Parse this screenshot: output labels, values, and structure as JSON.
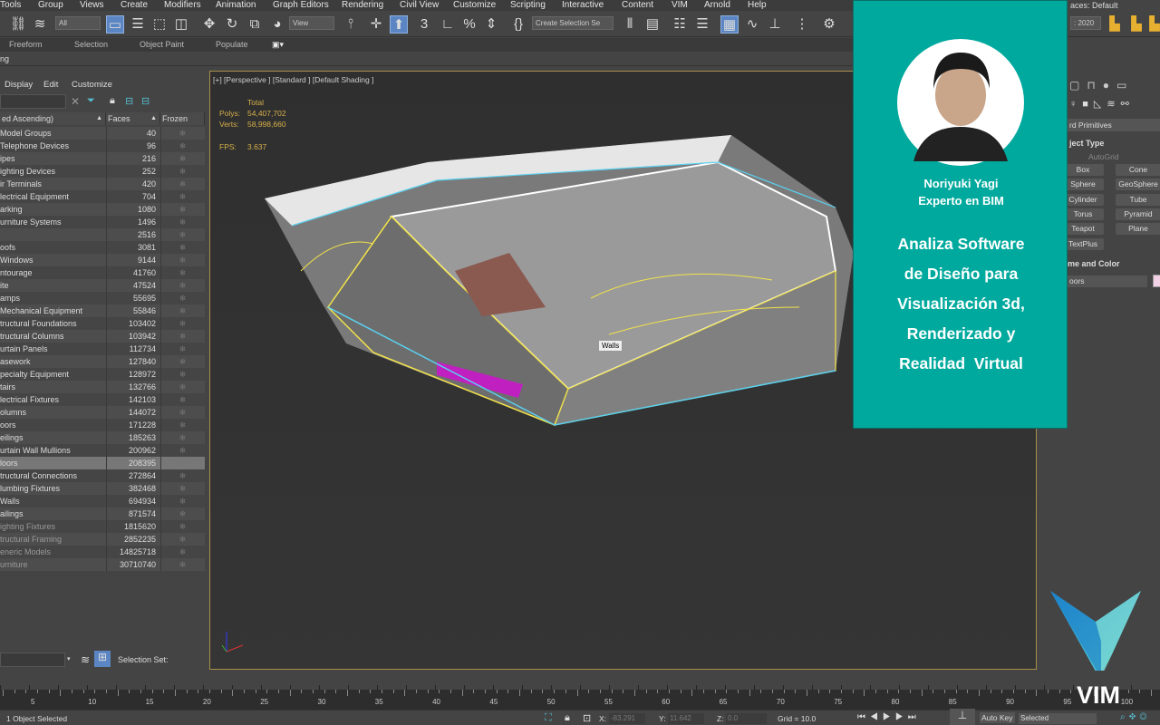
{
  "menu": [
    "Tools",
    "Group",
    "Views",
    "Create",
    "Modifiers",
    "Animation",
    "Graph Editors",
    "Rendering",
    "Civil View",
    "Customize",
    "Scripting",
    "Interactive",
    "Content",
    "VIM",
    "Arnold",
    "Help"
  ],
  "toolbar": {
    "filter": "All",
    "ref_coord": "View",
    "selection_set": "Create Selection Se",
    "workspace_label": "aces:",
    "workspace": "Default",
    "project": ": 2020"
  },
  "ribbon": [
    "Freeform",
    "Selection",
    "Object Paint",
    "Populate"
  ],
  "row2_text": "ng",
  "explorer": {
    "menu": [
      "Display",
      "Edit",
      "Customize"
    ],
    "columns": [
      "ed Ascending)",
      "Faces",
      "Frozen"
    ],
    "rows": [
      [
        "Model Groups",
        "40"
      ],
      [
        "Telephone Devices",
        "96"
      ],
      [
        "ipes",
        "216"
      ],
      [
        "ighting Devices",
        "252"
      ],
      [
        "ir Terminals",
        "420"
      ],
      [
        "lectrical Equipment",
        "704"
      ],
      [
        "arking",
        "1080"
      ],
      [
        "urniture Systems",
        "1496"
      ],
      [
        "",
        "2516"
      ],
      [
        "oofs",
        "3081"
      ],
      [
        "Windows",
        "9144"
      ],
      [
        "ntourage",
        "41760"
      ],
      [
        "ite",
        "47524"
      ],
      [
        "amps",
        "55695"
      ],
      [
        "Mechanical Equipment",
        "55846"
      ],
      [
        "tructural Foundations",
        "103402"
      ],
      [
        "tructural Columns",
        "103942"
      ],
      [
        "urtain Panels",
        "112734"
      ],
      [
        "asework",
        "127840"
      ],
      [
        "pecialty Equipment",
        "128972"
      ],
      [
        "tairs",
        "132766"
      ],
      [
        "lectrical Fixtures",
        "142103"
      ],
      [
        "olumns",
        "144072"
      ],
      [
        "oors",
        "171228"
      ],
      [
        "eilings",
        "185263"
      ],
      [
        "urtain Wall Mullions",
        "200962"
      ],
      [
        "loors",
        "208395"
      ],
      [
        "tructural Connections",
        "272864"
      ],
      [
        "lumbing Fixtures",
        "382468"
      ],
      [
        "Walls",
        "694934"
      ],
      [
        "ailings",
        "871574"
      ],
      [
        "ighting Fixtures",
        "1815620"
      ],
      [
        "tructural Framing",
        "2852235"
      ],
      [
        "eneric Models",
        "14825718"
      ],
      [
        "urniture",
        "30710740"
      ]
    ],
    "selected_row": 26,
    "dim_from": 31,
    "selection_set_label": "Selection Set:"
  },
  "viewport": {
    "label": "[+] [Perspective ] [Standard ] [Default Shading ]",
    "stats_header": "Total",
    "polys_label": "Polys:",
    "polys": "54,407,702",
    "verts_label": "Verts:",
    "verts": "58,998,660",
    "fps_label": "FPS:",
    "fps": "3.637",
    "tooltip": "Walls"
  },
  "command_panel": {
    "rollout": "rd Primitives",
    "object_type": "ject Type",
    "autogrid": "AutoGrid",
    "buttons": [
      "Box",
      "Cone",
      "Sphere",
      "GeoSphere",
      "Cylinder",
      "Tube",
      "Torus",
      "Pyramid",
      "Teapot",
      "Plane",
      "TextPlus"
    ],
    "name_color": "me and Color",
    "name": "oors",
    "color": "#f2d0e6"
  },
  "card": {
    "name": "Noriyuki Yagi",
    "role": "Experto en BIM",
    "headline": [
      "Analiza Software",
      "de Diseño para",
      "Visualización 3d,",
      "Renderizado y",
      "Realidad  Virtual"
    ],
    "bg": "#00a99d"
  },
  "logo": {
    "text": "VIM"
  },
  "timeline": {
    "ticks": [
      "5",
      "10",
      "15",
      "20",
      "25",
      "30",
      "35",
      "40",
      "45",
      "50",
      "55",
      "60",
      "65",
      "70",
      "75",
      "80",
      "85",
      "90",
      "95",
      "100"
    ]
  },
  "status": {
    "message": "1 Object Selected",
    "x_label": "X:",
    "x": "-83.291",
    "y_label": "Y:",
    "y": "11.642",
    "z_label": "Z:",
    "z": "0.0",
    "grid": "Grid = 10.0",
    "autokey": "Auto Key",
    "key_filter": "Selected"
  }
}
